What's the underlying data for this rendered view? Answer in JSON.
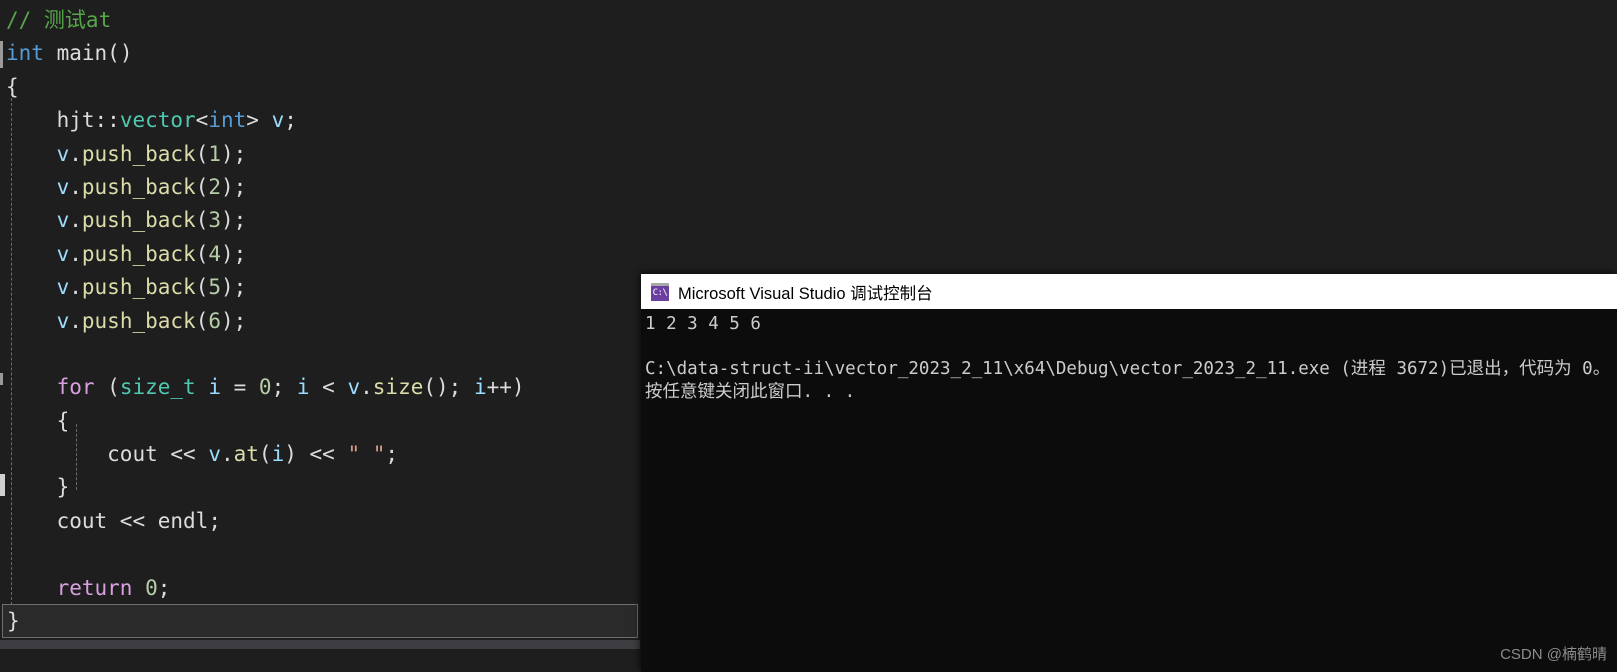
{
  "editor": {
    "name": "visual-studio-code-editor",
    "theme_background": "#1e1e1e",
    "lines": [
      {
        "id": "line-comment",
        "tokens": [
          {
            "text": "// 测试at",
            "cls": "c-comment"
          }
        ]
      },
      {
        "id": "line-main-signature",
        "tokens": [
          {
            "text": "int",
            "cls": "c-keyword"
          },
          {
            "text": " ",
            "cls": "c-plain"
          },
          {
            "text": "main",
            "cls": "c-plain"
          },
          {
            "text": "()",
            "cls": "c-punct"
          }
        ]
      },
      {
        "id": "line-open-brace",
        "tokens": [
          {
            "text": "{",
            "cls": "c-punct"
          }
        ]
      },
      {
        "id": "line-vector-decl",
        "tokens": [
          {
            "text": "    hjt",
            "cls": "c-plain"
          },
          {
            "text": "::",
            "cls": "c-punct"
          },
          {
            "text": "vector",
            "cls": "c-type"
          },
          {
            "text": "<",
            "cls": "c-punct"
          },
          {
            "text": "int",
            "cls": "c-keyword"
          },
          {
            "text": "> ",
            "cls": "c-punct"
          },
          {
            "text": "v",
            "cls": "c-var"
          },
          {
            "text": ";",
            "cls": "c-punct"
          }
        ]
      },
      {
        "id": "line-push-1",
        "tokens": [
          {
            "text": "    ",
            "cls": "c-plain"
          },
          {
            "text": "v",
            "cls": "c-var"
          },
          {
            "text": ".",
            "cls": "c-punct"
          },
          {
            "text": "push_back",
            "cls": "c-func"
          },
          {
            "text": "(",
            "cls": "c-punct"
          },
          {
            "text": "1",
            "cls": "c-num"
          },
          {
            "text": ");",
            "cls": "c-punct"
          }
        ]
      },
      {
        "id": "line-push-2",
        "tokens": [
          {
            "text": "    ",
            "cls": "c-plain"
          },
          {
            "text": "v",
            "cls": "c-var"
          },
          {
            "text": ".",
            "cls": "c-punct"
          },
          {
            "text": "push_back",
            "cls": "c-func"
          },
          {
            "text": "(",
            "cls": "c-punct"
          },
          {
            "text": "2",
            "cls": "c-num"
          },
          {
            "text": ");",
            "cls": "c-punct"
          }
        ]
      },
      {
        "id": "line-push-3",
        "tokens": [
          {
            "text": "    ",
            "cls": "c-plain"
          },
          {
            "text": "v",
            "cls": "c-var"
          },
          {
            "text": ".",
            "cls": "c-punct"
          },
          {
            "text": "push_back",
            "cls": "c-func"
          },
          {
            "text": "(",
            "cls": "c-punct"
          },
          {
            "text": "3",
            "cls": "c-num"
          },
          {
            "text": ");",
            "cls": "c-punct"
          }
        ]
      },
      {
        "id": "line-push-4",
        "tokens": [
          {
            "text": "    ",
            "cls": "c-plain"
          },
          {
            "text": "v",
            "cls": "c-var"
          },
          {
            "text": ".",
            "cls": "c-punct"
          },
          {
            "text": "push_back",
            "cls": "c-func"
          },
          {
            "text": "(",
            "cls": "c-punct"
          },
          {
            "text": "4",
            "cls": "c-num"
          },
          {
            "text": ");",
            "cls": "c-punct"
          }
        ]
      },
      {
        "id": "line-push-5",
        "tokens": [
          {
            "text": "    ",
            "cls": "c-plain"
          },
          {
            "text": "v",
            "cls": "c-var"
          },
          {
            "text": ".",
            "cls": "c-punct"
          },
          {
            "text": "push_back",
            "cls": "c-func"
          },
          {
            "text": "(",
            "cls": "c-punct"
          },
          {
            "text": "5",
            "cls": "c-num"
          },
          {
            "text": ");",
            "cls": "c-punct"
          }
        ]
      },
      {
        "id": "line-push-6",
        "tokens": [
          {
            "text": "    ",
            "cls": "c-plain"
          },
          {
            "text": "v",
            "cls": "c-var"
          },
          {
            "text": ".",
            "cls": "c-punct"
          },
          {
            "text": "push_back",
            "cls": "c-func"
          },
          {
            "text": "(",
            "cls": "c-punct"
          },
          {
            "text": "6",
            "cls": "c-num"
          },
          {
            "text": ");",
            "cls": "c-punct"
          }
        ]
      },
      {
        "id": "line-blank-1",
        "tokens": []
      },
      {
        "id": "line-for",
        "tokens": [
          {
            "text": "    ",
            "cls": "c-plain"
          },
          {
            "text": "for",
            "cls": "c-ctrl"
          },
          {
            "text": " (",
            "cls": "c-punct"
          },
          {
            "text": "size_t",
            "cls": "c-type"
          },
          {
            "text": " ",
            "cls": "c-plain"
          },
          {
            "text": "i",
            "cls": "c-var"
          },
          {
            "text": " = ",
            "cls": "c-punct"
          },
          {
            "text": "0",
            "cls": "c-num"
          },
          {
            "text": "; ",
            "cls": "c-punct"
          },
          {
            "text": "i",
            "cls": "c-var"
          },
          {
            "text": " < ",
            "cls": "c-punct"
          },
          {
            "text": "v",
            "cls": "c-var"
          },
          {
            "text": ".",
            "cls": "c-punct"
          },
          {
            "text": "size",
            "cls": "c-func"
          },
          {
            "text": "(); ",
            "cls": "c-punct"
          },
          {
            "text": "i",
            "cls": "c-var"
          },
          {
            "text": "++)",
            "cls": "c-punct"
          }
        ]
      },
      {
        "id": "line-for-open",
        "tokens": [
          {
            "text": "    {",
            "cls": "c-punct"
          }
        ]
      },
      {
        "id": "line-cout-at",
        "tokens": [
          {
            "text": "        ",
            "cls": "c-plain"
          },
          {
            "text": "cout",
            "cls": "c-plain"
          },
          {
            "text": " << ",
            "cls": "c-punct"
          },
          {
            "text": "v",
            "cls": "c-var"
          },
          {
            "text": ".",
            "cls": "c-punct"
          },
          {
            "text": "at",
            "cls": "c-func"
          },
          {
            "text": "(",
            "cls": "c-punct"
          },
          {
            "text": "i",
            "cls": "c-var"
          },
          {
            "text": ") << ",
            "cls": "c-punct"
          },
          {
            "text": "\" \"",
            "cls": "c-str"
          },
          {
            "text": ";",
            "cls": "c-punct"
          }
        ]
      },
      {
        "id": "line-for-close",
        "tokens": [
          {
            "text": "    }",
            "cls": "c-punct"
          }
        ]
      },
      {
        "id": "line-cout-endl",
        "tokens": [
          {
            "text": "    ",
            "cls": "c-plain"
          },
          {
            "text": "cout",
            "cls": "c-plain"
          },
          {
            "text": " << ",
            "cls": "c-punct"
          },
          {
            "text": "endl",
            "cls": "c-plain"
          },
          {
            "text": ";",
            "cls": "c-punct"
          }
        ]
      },
      {
        "id": "line-blank-2",
        "tokens": []
      },
      {
        "id": "line-return",
        "tokens": [
          {
            "text": "    ",
            "cls": "c-plain"
          },
          {
            "text": "return",
            "cls": "c-ctrl"
          },
          {
            "text": " ",
            "cls": "c-plain"
          },
          {
            "text": "0",
            "cls": "c-num"
          },
          {
            "text": ";",
            "cls": "c-punct"
          }
        ]
      }
    ],
    "closing_brace": "}"
  },
  "console": {
    "title": "Microsoft Visual Studio 调试控制台",
    "icon": "console-window-icon",
    "icon_glyph": "C:\\",
    "output_lines": [
      "1 2 3 4 5 6",
      "",
      "C:\\data-struct-ii\\vector_2023_2_11\\x64\\Debug\\vector_2023_2_11.exe (进程 3672)已退出，代码为 0。",
      "按任意键关闭此窗口. . ."
    ]
  },
  "watermark": {
    "text": "CSDN @楠鹤晴"
  }
}
